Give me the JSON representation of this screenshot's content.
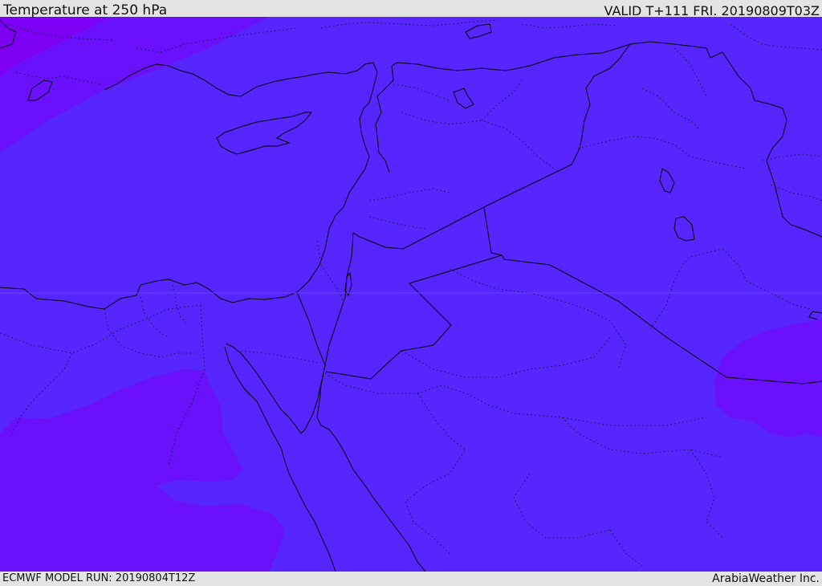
{
  "header": {
    "title": "Temperature at 250 hPa",
    "valid_time": "VALID T+111 FRI. 20190809T03Z"
  },
  "footer": {
    "model_run": "ECMWF MODEL RUN: 20190804T12Z",
    "credit": "ArabiaWeather Inc."
  },
  "colors": {
    "field_main": "#5726ff",
    "field_cold": "#6a10fb",
    "field_colder": "#7d00f5",
    "coastline": "#000000",
    "border_dotted": "#1a1a66"
  }
}
